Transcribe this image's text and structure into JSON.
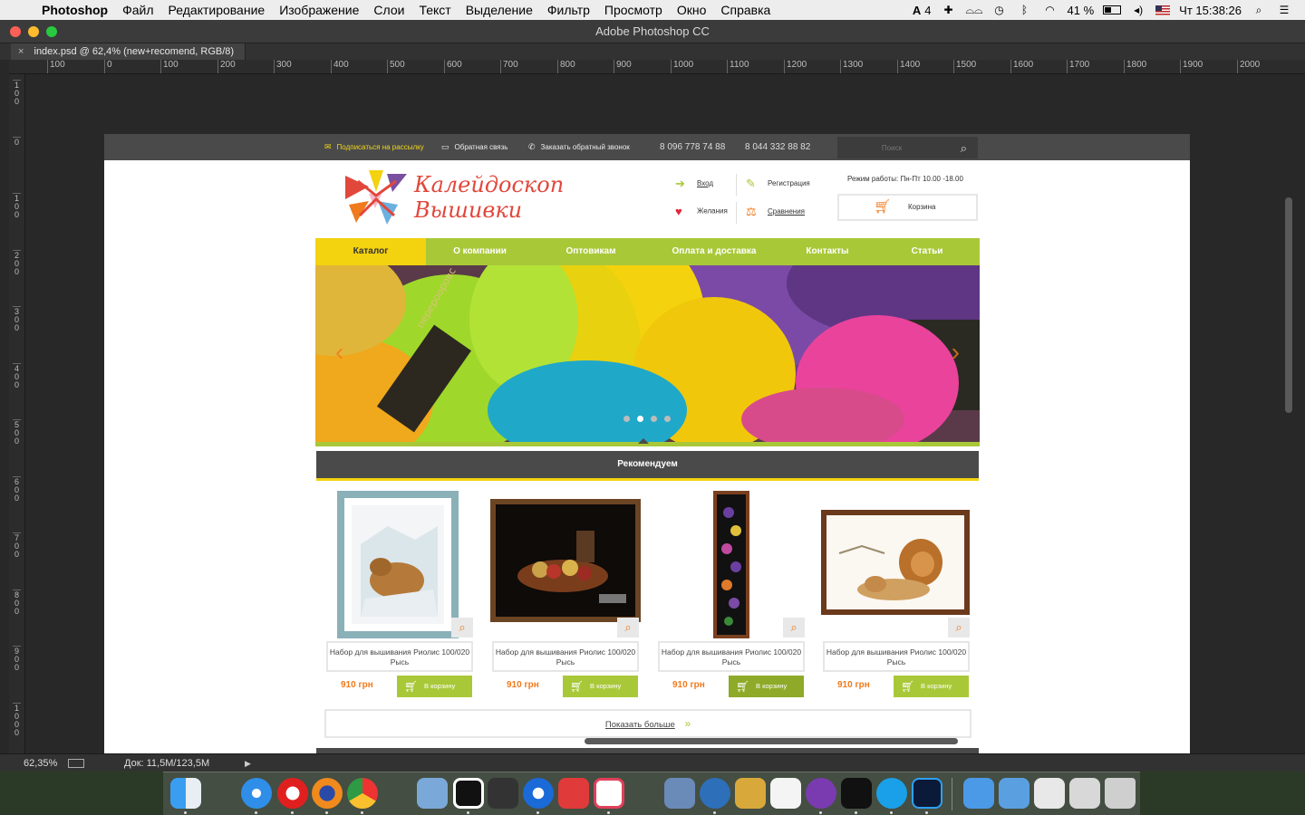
{
  "menubar": {
    "app_name": "Photoshop",
    "items": [
      "Файл",
      "Редактирование",
      "Изображение",
      "Слои",
      "Текст",
      "Выделение",
      "Фильтр",
      "Просмотр",
      "Окно",
      "Справка"
    ],
    "status": {
      "adobe_badge": "4",
      "battery": "41 %",
      "clock": "Чт 15:38:26"
    }
  },
  "window": {
    "title": "Adobe Photoshop CC",
    "doc_tab": "index.psd @ 62,4% (new+recomend, RGB/8)",
    "ruler_h": [
      "100",
      "0",
      "100",
      "200",
      "300",
      "400",
      "500",
      "600",
      "700",
      "800",
      "900",
      "1000",
      "1100",
      "1200",
      "1300",
      "1400",
      "1500",
      "1600",
      "1700",
      "1800",
      "1900",
      "2000"
    ],
    "ruler_v": [
      "100",
      "0",
      "100",
      "200",
      "300",
      "400",
      "500",
      "600",
      "700",
      "800",
      "900",
      "1000"
    ],
    "zoom": "62,35%",
    "doc_info": "Док: 11,5M/123,5M"
  },
  "site": {
    "topbar": {
      "subscribe": "Подписаться на рассылку",
      "feedback": "Обратная связь",
      "callback": "Заказать обратный звонок",
      "phone1": "8 096 778 74 88",
      "phone2": "8 044 332 88 82",
      "search_placeholder": "Поиск"
    },
    "logo": {
      "line1": "Калейдоскоп",
      "line2": "Вышивки"
    },
    "account": {
      "login": "Вход",
      "register": "Регистрация",
      "wishlist": "Желания",
      "compare": "Сравнения"
    },
    "hours": "Режим работы: Пн-Пт 10.00 -18.00",
    "cart": "Корзина",
    "nav": [
      "Каталог",
      "О компании",
      "Оптовикам",
      "Оплата и доставка",
      "Контакты",
      "Статьи"
    ],
    "slider_label": "перерооровс",
    "section_title": "Рекомендуем",
    "products": [
      {
        "title": "Набор для вышивания Риолис 100/020 Рысь",
        "price": "910 грн",
        "buy": "В корзину"
      },
      {
        "title": "Набор для вышивания Риолис 100/020 Рысь",
        "price": "910 грн",
        "buy": "В корзину"
      },
      {
        "title": "Набор для вышивания Риолис 100/020 Рысь",
        "price": "910 грн",
        "buy": "В корзину"
      },
      {
        "title": "Набор для вышивания Риолис 100/020 Рысь",
        "price": "910 грн",
        "buy": "В корзину"
      }
    ],
    "show_more": "Показать больше"
  },
  "colors": {
    "accent_green": "#a9c838",
    "accent_yellow": "#f3d20f",
    "accent_orange": "#f07a1c",
    "logo_red": "#e2473b",
    "dark_bar": "#4a4a4a"
  }
}
